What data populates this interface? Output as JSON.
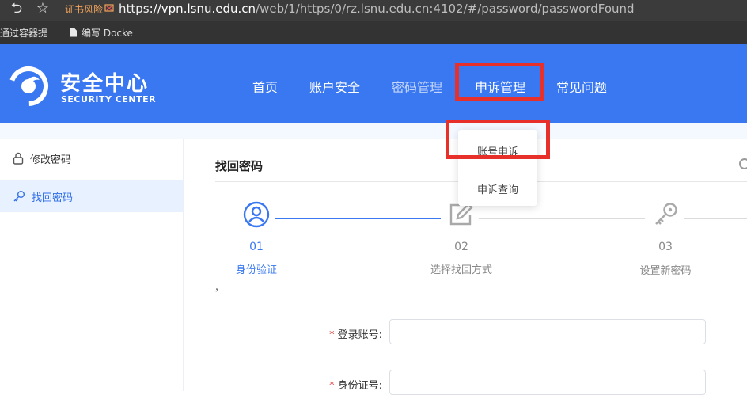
{
  "browser": {
    "back_glyph": "⮌",
    "star_glyph": "☆",
    "cert_warning": "证书风险",
    "cert_icon": "cert-warning-icon",
    "url_scheme": "https",
    "url_host": "://vpn.lsnu.edu.cn",
    "url_rest": "/web/1/https/0/rz.lsnu.edu.cn:4102/#/password/passwordFound",
    "bookmarks": [
      "通过容器提",
      "编写 Docke"
    ]
  },
  "header": {
    "brand_cn": "安全中心",
    "brand_en": "SECURITY CENTER",
    "nav": [
      "首页",
      "账户安全",
      "密码管理",
      "申诉管理",
      "常见问题"
    ],
    "bg_color": "#3a78f2"
  },
  "dropdown": {
    "items": [
      "账号申诉",
      "申诉查询"
    ]
  },
  "sidebar": {
    "items": [
      "修改密码",
      "找回密码"
    ]
  },
  "main": {
    "title": "找回密码",
    "steps": [
      {
        "num": "01",
        "label": "身份验证",
        "state": "active"
      },
      {
        "num": "02",
        "label": "选择找回方式",
        "state": "pending"
      },
      {
        "num": "03",
        "label": "设置新密码",
        "state": "pending"
      }
    ],
    "stray_mark": "，",
    "form": {
      "required_mark": "*",
      "fields": [
        "登录账号:",
        "身份证号:"
      ]
    }
  },
  "colors": {
    "accent": "#3a78f2",
    "highlight": "#e8302a",
    "required": "#e03a3a"
  }
}
